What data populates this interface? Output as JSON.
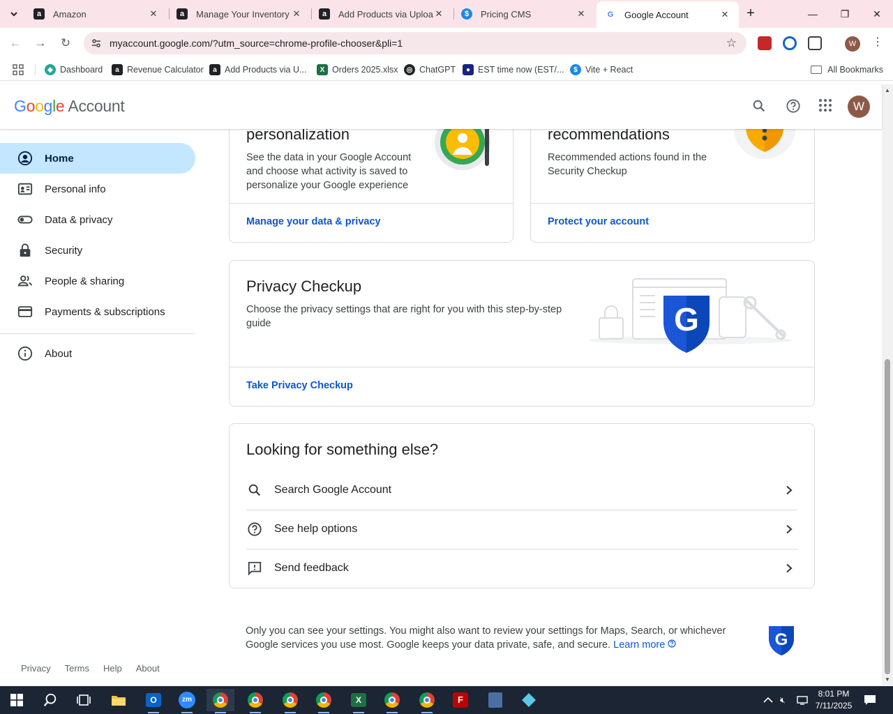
{
  "browser": {
    "tabs": [
      {
        "title": "Amazon",
        "favicon": "amazon-icon",
        "active": false
      },
      {
        "title": "Manage Your Inventory",
        "favicon": "amazon-icon",
        "active": false
      },
      {
        "title": "Add Products via Upload",
        "favicon": "amazon-icon",
        "active": false
      },
      {
        "title": "Pricing CMS",
        "favicon": "dollar-icon",
        "active": false
      },
      {
        "title": "Google Account",
        "favicon": "google-icon",
        "active": true
      }
    ],
    "url": "myaccount.google.com/?utm_source=chrome-profile-chooser&pli=1",
    "profile_initial": "W",
    "bookmarks": [
      {
        "label": "Dashboard",
        "icon": "dashboard-icon"
      },
      {
        "label": "Revenue Calculator",
        "icon": "amazon-icon"
      },
      {
        "label": "Add Products via U...",
        "icon": "amazon-icon"
      },
      {
        "label": "Orders 2025.xlsx",
        "icon": "excel-icon"
      },
      {
        "label": "ChatGPT",
        "icon": "chatgpt-icon"
      },
      {
        "label": "EST time now (EST/...",
        "icon": "clock-icon"
      },
      {
        "label": "Vite + React",
        "icon": "dollar-icon"
      }
    ],
    "all_bookmarks": "All Bookmarks"
  },
  "header": {
    "logo_word": "Google",
    "logo_product": "Account",
    "avatar_initial": "W"
  },
  "sidebar": {
    "items": [
      {
        "label": "Home",
        "icon": "account-circle-icon",
        "active": true
      },
      {
        "label": "Personal info",
        "icon": "id-card-icon",
        "active": false
      },
      {
        "label": "Data & privacy",
        "icon": "toggle-icon",
        "active": false
      },
      {
        "label": "Security",
        "icon": "lock-icon",
        "active": false
      },
      {
        "label": "People & sharing",
        "icon": "people-icon",
        "active": false
      },
      {
        "label": "Payments & subscriptions",
        "icon": "credit-card-icon",
        "active": false
      },
      {
        "label": "About",
        "icon": "info-icon",
        "active": false
      }
    ]
  },
  "cards": {
    "privacy_personalization": {
      "title": "personalization",
      "desc": "See the data in your Google Account and choose what activity is saved to personalize your Google experience",
      "link": "Manage your data & privacy"
    },
    "security_recommendations": {
      "title": "recommendations",
      "desc": "Recommended actions found in the Security Checkup",
      "link": "Protect your account"
    },
    "privacy_checkup": {
      "title": "Privacy Checkup",
      "desc": "Choose the privacy settings that are right for you with this step-by-step guide",
      "link": "Take Privacy Checkup",
      "shield_letter": "G"
    },
    "looking_else": {
      "title": "Looking for something else?",
      "rows": [
        {
          "label": "Search Google Account",
          "icon": "search-icon"
        },
        {
          "label": "See help options",
          "icon": "help-circle-icon"
        },
        {
          "label": "Send feedback",
          "icon": "feedback-icon"
        }
      ]
    }
  },
  "note": {
    "text": "Only you can see your settings. You might also want to review your settings for Maps, Search, or whichever Google services you use most. Google keeps your data private, safe, and secure.",
    "learn_more": "Learn more",
    "shield_letter": "G"
  },
  "footer": {
    "links": [
      "Privacy",
      "Terms",
      "Help",
      "About"
    ]
  },
  "taskbar": {
    "time": "8:01 PM",
    "date": "7/11/2025"
  },
  "colors": {
    "accent": "#0b57d0",
    "nav_active": "#c2e7ff",
    "tabstrip": "#fbe4e9"
  }
}
